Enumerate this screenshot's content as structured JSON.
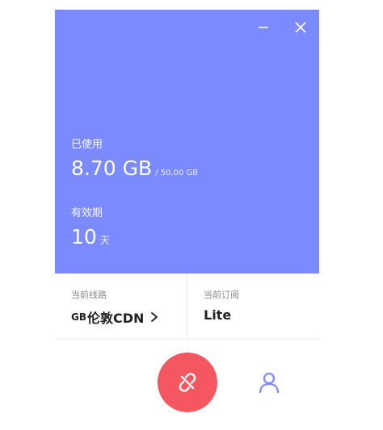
{
  "usage": {
    "label": "已使用",
    "used_value": "8.70 GB",
    "total_text": "/ 50.00 GB"
  },
  "validity": {
    "label": "有效期",
    "days_value": "10",
    "days_unit": "天"
  },
  "route": {
    "title": "当前线路",
    "prefix": "GB",
    "name": "伦敦CDN"
  },
  "subscription": {
    "title": "当前订阅",
    "plan": "Lite"
  },
  "icons": {
    "minimize": "minimize-icon",
    "close": "close-icon",
    "route_arrow": "chevron-right-icon",
    "connect": "unlink-icon",
    "user": "user-icon"
  },
  "colors": {
    "panel": "#7b8bff",
    "connect_button": "#f4575f",
    "user_icon": "#7b8bff"
  }
}
